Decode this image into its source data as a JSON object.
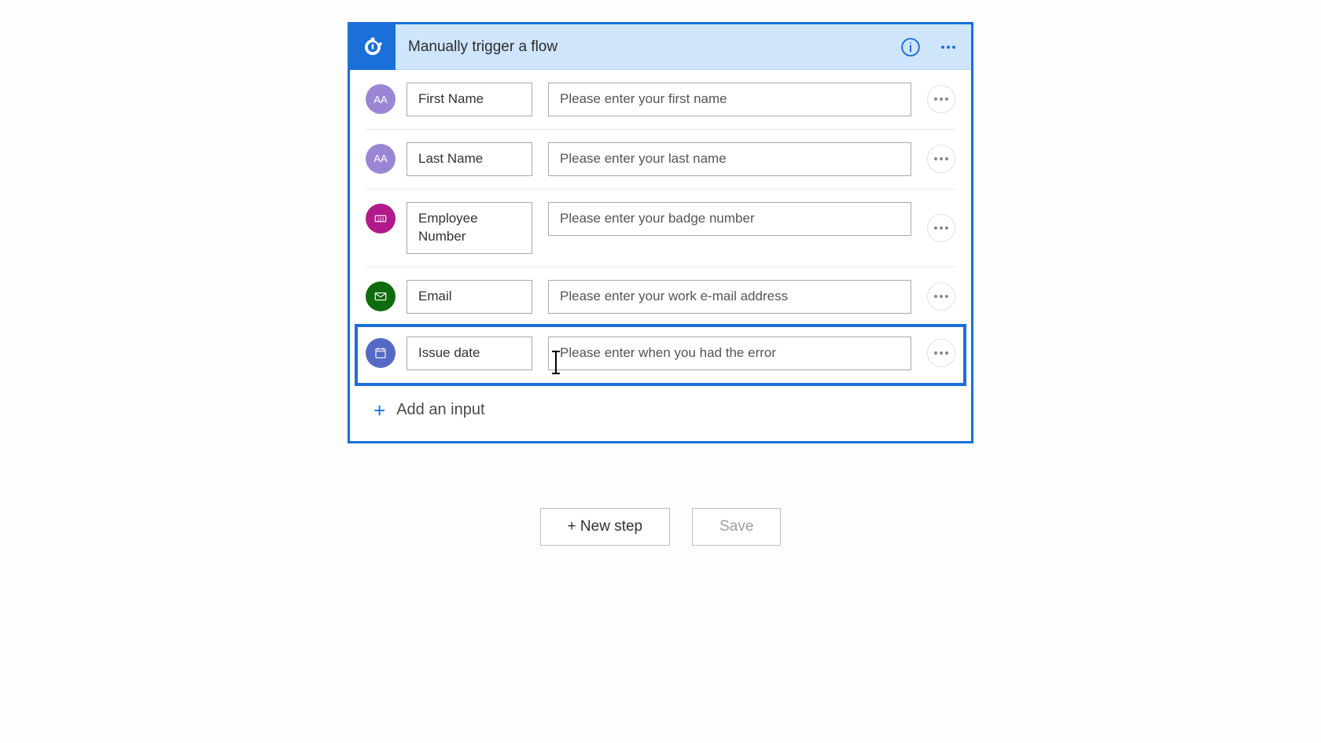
{
  "card": {
    "title": "Manually trigger a flow",
    "addLabel": "Add an input"
  },
  "rows": [
    {
      "label": "First Name",
      "desc": "Please enter your first name"
    },
    {
      "label": "Last Name",
      "desc": "Please enter your last name"
    },
    {
      "label": "Employee Number",
      "desc": "Please enter your badge number"
    },
    {
      "label": "Email",
      "desc": "Please enter your work e-mail address"
    },
    {
      "label": "Issue date",
      "desc": "Please enter when you had the error"
    }
  ],
  "footer": {
    "newStep": "+ New step",
    "save": "Save"
  }
}
